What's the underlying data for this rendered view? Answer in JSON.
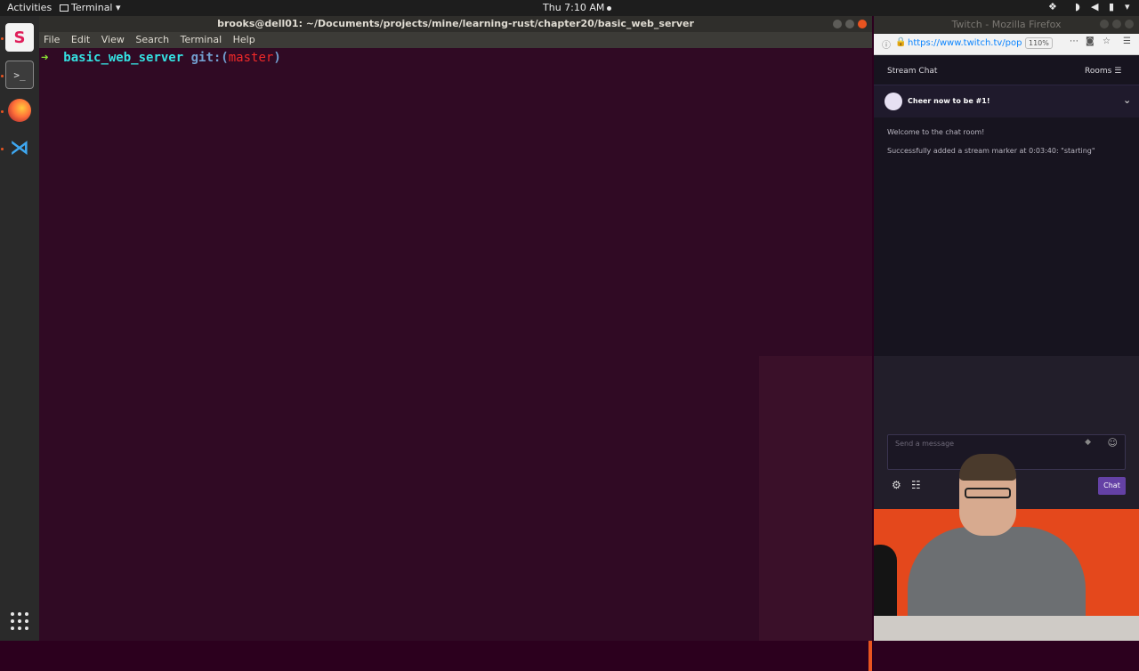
{
  "topbar": {
    "activities": "Activities",
    "app_menu": "Terminal",
    "clock": "Thu  7:10 AM"
  },
  "dock": {
    "apps": [
      "slack-icon",
      "terminal-icon",
      "firefox-icon",
      "vscode-icon"
    ],
    "show_apps_icon": "grid-icon"
  },
  "terminal": {
    "title": "brooks@dell01: ~/Documents/projects/mine/learning-rust/chapter20/basic_web_server",
    "menu": [
      "File",
      "Edit",
      "View",
      "Search",
      "Terminal",
      "Help"
    ],
    "prompt_arrow": "➜",
    "prompt_dir": "basic_web_server",
    "prompt_git": "git:(",
    "prompt_branch": "master",
    "prompt_close": ")"
  },
  "firefox": {
    "title": "Twitch - Mozilla Firefox",
    "url": "https://www.twitch.tv/pop",
    "zoom": "110%",
    "chat": {
      "header": "Stream Chat",
      "rooms": "Rooms",
      "cheer": "Cheer now to be #1!",
      "messages": [
        "Welcome to the chat room!",
        "Successfully added a stream marker at 0:03:40: \"starting\""
      ],
      "input_placeholder": "Send a message",
      "chat_button": "Chat"
    }
  },
  "colors": {
    "terminal_bg": "#300a24",
    "accent": "#e95420",
    "twitch_purple": "#6441a5"
  }
}
